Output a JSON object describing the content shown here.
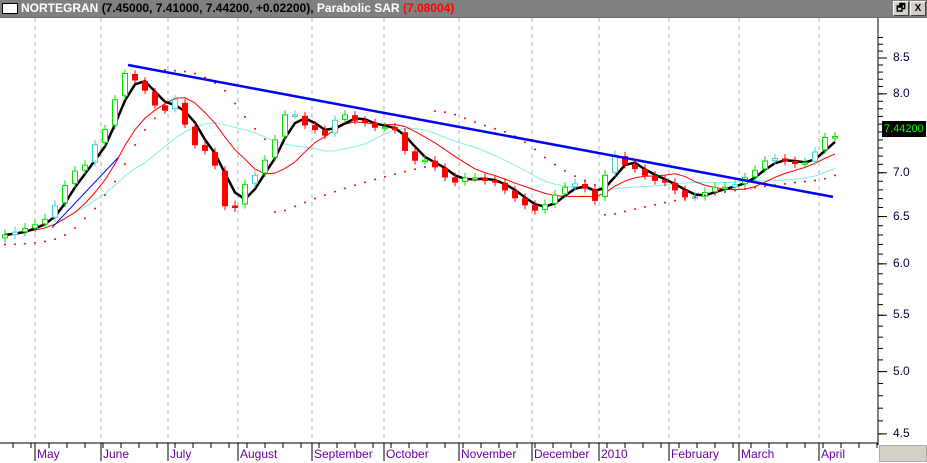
{
  "title": {
    "symbol": "NORTEGRAN",
    "ohlc": "(7.45000, 7.41000, 7.44200, +0.02200),",
    "indicator": "Parabolic SAR",
    "indicator_value": "(7.08004)"
  },
  "window_buttons": {
    "restore": "🗗",
    "close": "X"
  },
  "last_price_label": "7.44200",
  "colors": {
    "up": "#00e000",
    "up_alt": "#40d0d0",
    "down": "#ff0000",
    "trend": "#0000ff",
    "ma_fast": "#000000",
    "ma_mid": "#ff0000",
    "ma_slow": "#80f0e0",
    "sar": "#ff0000",
    "titlebar": "#808080"
  },
  "chart_data": {
    "type": "candlestick",
    "symbol": "NORTEGRAN",
    "x_tick_labels": [
      "May",
      "June",
      "July",
      "August",
      "September",
      "October",
      "November",
      "December",
      "2010",
      "February",
      "March",
      "April"
    ],
    "y_tick_labels": [
      "8.5",
      "8.0",
      "7.0",
      "6.5",
      "6.0",
      "5.5",
      "5.0",
      "4.5"
    ],
    "y_scale": "log",
    "ylim": [
      4.4,
      8.8
    ],
    "grid": "vertical dashed at month starts",
    "closes": [
      6.3,
      6.33,
      6.37,
      6.41,
      6.47,
      6.62,
      6.85,
      7.02,
      7.09,
      7.34,
      7.53,
      7.92,
      8.28,
      8.19,
      8.05,
      7.85,
      7.78,
      7.92,
      7.6,
      7.34,
      7.27,
      7.09,
      6.62,
      6.6,
      6.86,
      6.97,
      7.15,
      7.4,
      7.72,
      7.72,
      7.59,
      7.53,
      7.46,
      7.65,
      7.72,
      7.65,
      7.62,
      7.56,
      7.56,
      7.53,
      7.27,
      7.15,
      7.15,
      7.07,
      6.95,
      6.89,
      6.94,
      6.94,
      6.91,
      6.89,
      6.8,
      6.71,
      6.63,
      6.57,
      6.63,
      6.74,
      6.83,
      6.87,
      6.82,
      6.68,
      6.97,
      7.21,
      7.1,
      7.05,
      6.97,
      6.91,
      6.89,
      6.8,
      6.72,
      6.72,
      6.77,
      6.83,
      6.83,
      6.86,
      6.94,
      7.03,
      7.14,
      7.17,
      7.14,
      7.11,
      7.12,
      7.25,
      7.43,
      7.442
    ],
    "last": {
      "open": 7.45,
      "high": 7.41,
      "low": 7.442,
      "close": 7.442,
      "change": 0.022
    },
    "parabolic_sar_last": 7.08004,
    "moving_average_periods": [
      3,
      8,
      15
    ],
    "trendline": {
      "from": {
        "bar": 12.3,
        "price": 8.4
      },
      "to": {
        "bar": 82.8,
        "price": 6.72
      }
    },
    "support_line": {
      "from": {
        "bar": 4.7,
        "price": 6.38
      },
      "to": {
        "bar": 11.3,
        "price": 7.18
      }
    }
  }
}
